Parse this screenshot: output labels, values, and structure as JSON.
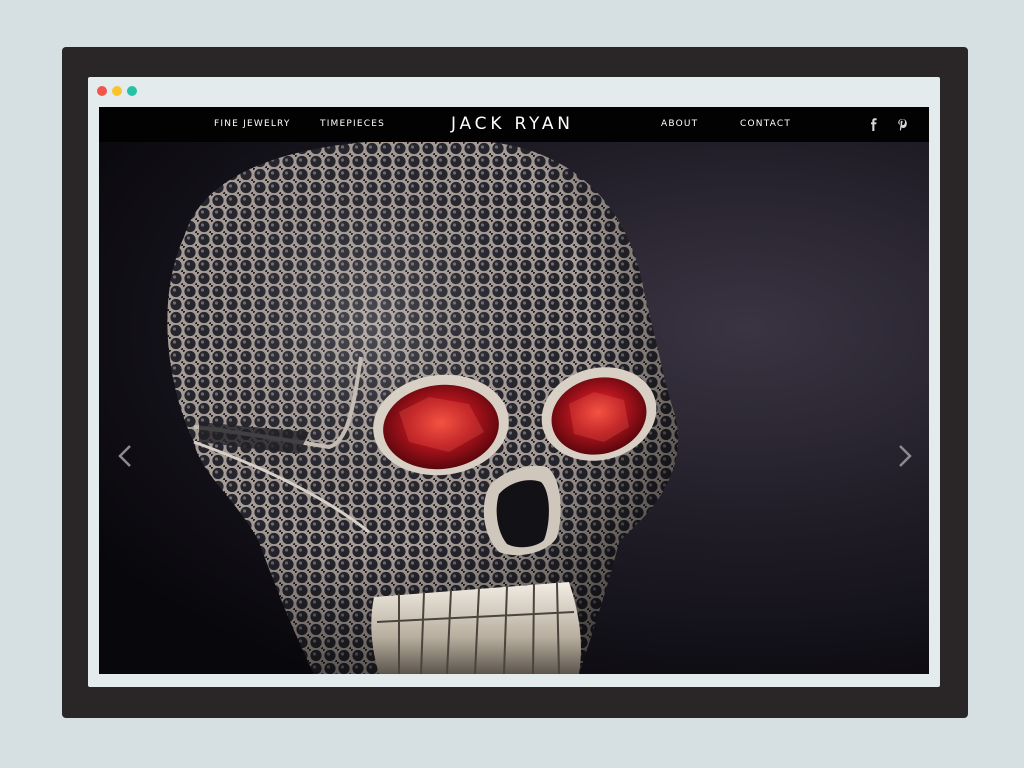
{
  "nav": {
    "fine_jewelry": "FINE JEWELRY",
    "timepieces": "TIMEPIECES",
    "brand": "JACK RYAN",
    "about": "ABOUT",
    "contact": "CONTACT"
  },
  "social": [
    "facebook-icon",
    "pinterest-icon"
  ],
  "window_dots": [
    "#f0574a",
    "#f7c52b",
    "#27c1a6"
  ],
  "colors": {
    "nav_bg": "#020203",
    "gem_red": "#b3141e",
    "stone_dark": "#2b2a30"
  }
}
